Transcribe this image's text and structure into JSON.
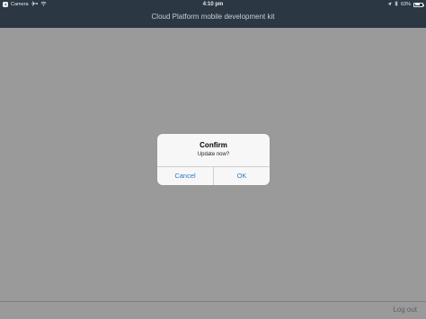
{
  "status_bar": {
    "back_app_label": "Camera",
    "time": "4:10 pm",
    "battery_percent": "63%",
    "battery_level": 0.63,
    "icons": [
      "back-arrow-icon",
      "airplane-icon",
      "wifi-icon",
      "location-icon",
      "bluetooth-icon",
      "battery-icon"
    ]
  },
  "header": {
    "title": "Cloud Platform mobile development kit"
  },
  "dialog": {
    "title": "Confirm",
    "message": "Update now?",
    "cancel_label": "Cancel",
    "ok_label": "OK"
  },
  "toolbar": {
    "logout_label": "Log out"
  },
  "colors": {
    "header_bg": "#2b3743",
    "overlay_bg": "#9a9a9a",
    "dialog_bg": "#f7f7f7",
    "button_text": "#2a79c8"
  }
}
